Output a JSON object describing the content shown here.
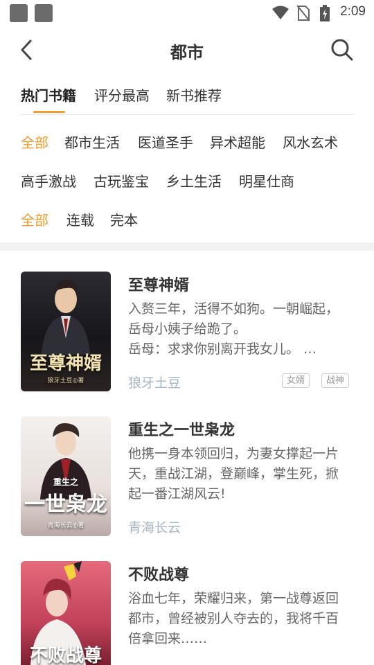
{
  "status_bar": {
    "time": "2:09",
    "icons": [
      "wifi-icon",
      "no-sim-icon",
      "battery-charging-icon"
    ]
  },
  "header": {
    "title": "都市",
    "back_icon": "chevron-left-icon",
    "search_icon": "search-icon"
  },
  "tabs": [
    {
      "label": "热门书籍",
      "active": true
    },
    {
      "label": "评分最高",
      "active": false
    },
    {
      "label": "新书推荐",
      "active": false
    }
  ],
  "category_filters": {
    "row1": [
      {
        "label": "全部",
        "active": true
      },
      {
        "label": "都市生活",
        "active": false
      },
      {
        "label": "医道圣手",
        "active": false
      },
      {
        "label": "异术超能",
        "active": false
      },
      {
        "label": "风水玄术",
        "active": false
      }
    ],
    "row2": [
      {
        "label": "高手激战",
        "active": false
      },
      {
        "label": "古玩鉴宝",
        "active": false
      },
      {
        "label": "乡土生活",
        "active": false
      },
      {
        "label": "明星仕商",
        "active": false
      }
    ]
  },
  "status_filters": [
    {
      "label": "全部",
      "active": true
    },
    {
      "label": "连载",
      "active": false
    },
    {
      "label": "完本",
      "active": false
    }
  ],
  "books": [
    {
      "title": "至尊神婿",
      "description": "入赘三年，活得不如狗。一朝崛起，岳母小姨子给跪了。\n 岳母：求求你别离开我女儿。 …",
      "author": "狼牙土豆",
      "tags": [
        "女婿",
        "战神"
      ],
      "cover_title": "至尊神婿",
      "cover_author": "狼牙土豆◎著",
      "colors": {
        "cover_bg": "#1b1a20",
        "cover_accent": "#d8a13a"
      }
    },
    {
      "title": "重生之一世枭龙",
      "description": "他携一身本领回归，为妻女撑起一片天，重战江湖，登巅峰，掌生死，掀起一番江湖风云!",
      "author": "青海长云",
      "tags": [],
      "cover_title": "一世枭龙",
      "cover_subtitle": "重生之",
      "cover_author": "青海长云◎著",
      "colors": {
        "cover_bg": "#f2efec",
        "cover_accent": "#8a1f1f"
      }
    },
    {
      "title": "不败战尊",
      "description": "浴血七年，荣耀归来，第一战尊返回都市，曾经被别人夺去的，我将千百倍拿回来……",
      "author": "",
      "tags": [],
      "cover_title": "不败战尊",
      "colors": {
        "cover_bg": "#c94a5b",
        "cover_accent": "#f5d33b"
      }
    }
  ],
  "colors": {
    "accent": "#f39c2b",
    "text_primary": "#333333",
    "text_secondary": "#666666",
    "author": "#a7b4c4",
    "band": "#f2f2f2"
  }
}
